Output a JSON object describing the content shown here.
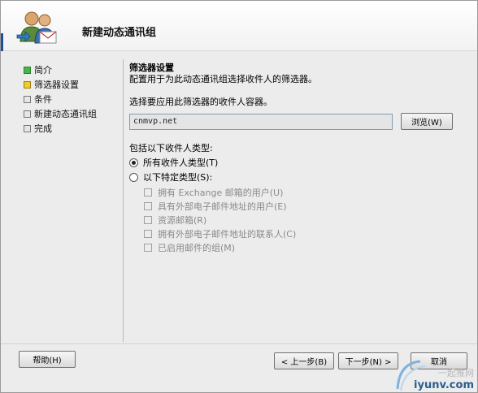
{
  "window": {
    "title": "新建动态通讯组"
  },
  "nav": {
    "items": [
      {
        "label": "简介",
        "state": "done"
      },
      {
        "label": "筛选器设置",
        "state": "current"
      },
      {
        "label": "条件",
        "state": "pending"
      },
      {
        "label": "新建动态通讯组",
        "state": "pending"
      },
      {
        "label": "完成",
        "state": "pending"
      }
    ]
  },
  "content": {
    "section_title": "筛选器设置",
    "description": "配置用于为此动态通讯组选择收件人的筛选器。",
    "container_prompt": "选择要应用此筛选器的收件人容器。",
    "container_value": "cnmvp.net",
    "browse_label": "浏览(W)",
    "include_label": "包括以下收件人类型:",
    "radio_all": "所有收件人类型(T)",
    "radio_specific": "以下特定类型(S):",
    "types": [
      "拥有 Exchange 邮箱的用户(U)",
      "具有外部电子邮件地址的用户(E)",
      "资源邮箱(R)",
      "拥有外部电子邮件地址的联系人(C)",
      "已启用邮件的组(M)"
    ]
  },
  "footer": {
    "help_label": "帮助(H)",
    "back_label": "< 上一步(B)",
    "next_label": "下一步(N) >",
    "cancel_label": "取消"
  },
  "watermark": {
    "top": "一起推网",
    "bottom": "iyunv.com"
  },
  "colors": {
    "nav_done": "#49b649",
    "nav_current": "#f3cc2a",
    "watermark_blue": "#2a5e8e"
  }
}
